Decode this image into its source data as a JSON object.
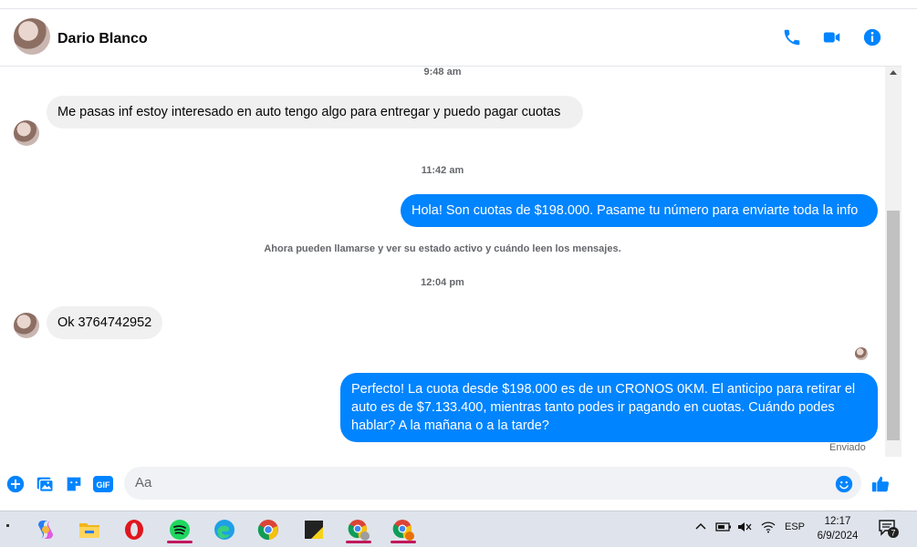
{
  "contact": {
    "name": "Dario Blanco"
  },
  "header_icons": [
    "phone-icon",
    "video-call-icon",
    "info-icon"
  ],
  "timestamps": [
    "9:48 am",
    "11:42 am",
    "12:04 pm"
  ],
  "messages": [
    {
      "direction": "in",
      "text": "Me pasas inf estoy interesado en auto tengo algo para entregar y puedo pagar cuotas"
    },
    {
      "direction": "out",
      "text": "Hola! Son cuotas de $198.000. Pasame tu número para enviarte toda la info"
    },
    {
      "direction": "in",
      "text": "Ok 3764742952"
    },
    {
      "direction": "out",
      "text": "Perfecto! La cuota desde $198.000 es de un CRONOS 0KM. El anticipo para retirar el auto es de $7.133.400, mientras tanto podes ir pagando en cuotas. Cuándo podes hablar? A la mañana o a la tarde?"
    }
  ],
  "system_notice": "Ahora pueden llamarse y ver su estado activo y cuándo leen los mensajes.",
  "delivery_status": "Enviado",
  "composer": {
    "placeholder": "Aa",
    "icons": [
      "plus-icon",
      "image-icon",
      "sticker-icon",
      "gif-icon",
      "emoji-icon",
      "like-icon"
    ],
    "gif_label": "GIF"
  },
  "taskbar": {
    "apps": [
      "copilot",
      "file-explorer",
      "opera",
      "spotify",
      "edge",
      "chrome",
      "sticky-notes",
      "chrome-profile-1",
      "chrome-profile-2"
    ],
    "tray": {
      "language": "ESP"
    },
    "clock": {
      "time": "12:17",
      "date": "6/9/2024"
    },
    "notifications_count": "7"
  },
  "colors": {
    "accent": "#0084ff",
    "incoming_bubble": "#f0f0f0",
    "taskbar": "#dfe4ec"
  }
}
